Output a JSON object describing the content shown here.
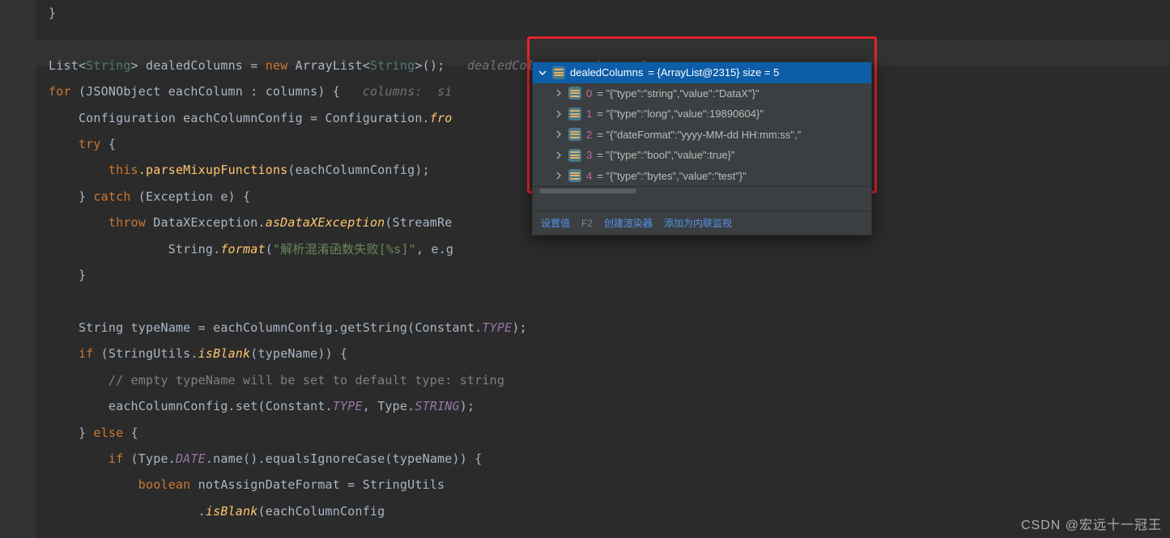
{
  "hints": {
    "dealed": "dealedColumns:  size = 5",
    "columns_prefix": "columns:  si"
  },
  "code": {
    "l0": "}",
    "l2_a": "List",
    "l2_b": "String",
    "l2_c": " dealedColumns = ",
    "l2_d": "new",
    "l2_e": " ArrayList",
    "l2_f": "String",
    "l2_g": "();",
    "l3_a": "for",
    "l3_b": " (JSONObject eachColumn : columns) {",
    "l4_a": "Configuration eachColumnConfig = Configuration.",
    "l4_b": "fro",
    "l5_a": "try",
    "l5_b": " {",
    "l6_a": "this",
    "l6_b": ".parseMixupFunctions",
    "l6_c": "(eachColumnConfig);",
    "l7_a": "} ",
    "l7_b": "catch",
    "l7_c": " (Exception e) {",
    "l8_a": "throw",
    "l8_b": " DataXException.",
    "l8_c": "asDataXException",
    "l8_d": "(StreamRe",
    "l9_a": "String.",
    "l9_b": "format",
    "l9_c": "(",
    "l9_d": "\"解析混淆函数失败[%s]\"",
    "l9_e": ", e.g",
    "l10": "}",
    "l12_a": "String typeName = eachColumnConfig.getString(Constant.",
    "l12_b": "TYPE",
    "l12_c": ");",
    "l13_a": "if",
    "l13_b": " (StringUtils.",
    "l13_c": "isBlank",
    "l13_d": "(typeName)) {",
    "l14": "// empty typeName will be set to default type: string",
    "l15_a": "eachColumnConfig.set(Constant.",
    "l15_b": "TYPE",
    "l15_c": ", Type.",
    "l15_d": "STRING",
    "l15_e": ");",
    "l16_a": "} ",
    "l16_b": "else",
    "l16_c": " {",
    "l17_a": "if",
    "l17_b": " (Type.",
    "l17_c": "DATE",
    "l17_d": ".name().equalsIgnoreCase(typeName)) {",
    "l18_a": "boolean",
    "l18_b": " notAssignDateFormat = StringUtils",
    "l19_a": ".",
    "l19_b": "isBlank",
    "l19_c": "(eachColumnConfig"
  },
  "debugger": {
    "root_name": "dealedColumns",
    "root_val": " = {ArrayList@2315}  size = 5",
    "items": [
      {
        "name": "0",
        "val": " = \"{\"type\":\"string\",\"value\":\"DataX\"}\""
      },
      {
        "name": "1",
        "val": " = \"{\"type\":\"long\",\"value\":19890604}\""
      },
      {
        "name": "2",
        "val": " = \"{\"dateFormat\":\"yyyy-MM-dd HH:mm:ss\",\""
      },
      {
        "name": "3",
        "val": " = \"{\"type\":\"bool\",\"value\":true}\""
      },
      {
        "name": "4",
        "val": " = \"{\"type\":\"bytes\",\"value\":\"test\"}\""
      }
    ],
    "footer": {
      "set_value": "设置值",
      "hotkey": "F2",
      "create_renderer": "创建渲染器",
      "add_watch": "添加为内联监视"
    }
  },
  "watermark": "CSDN @宏远十一冠王"
}
